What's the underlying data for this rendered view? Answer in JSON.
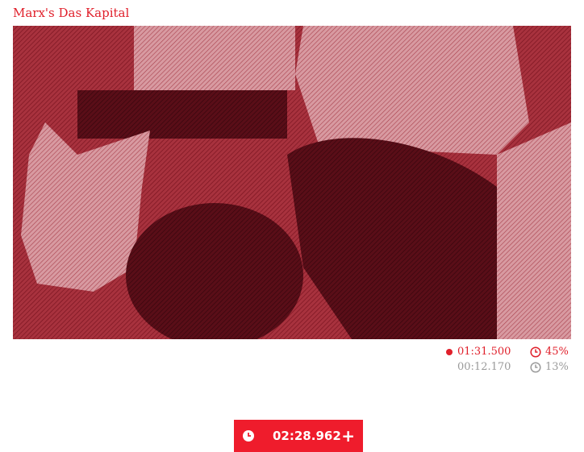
{
  "header": {
    "title": "Marx's Das Kapital"
  },
  "video": {
    "description_icon": "video-preview"
  },
  "stats": {
    "primary": {
      "time": "01:31.500",
      "percent": "45%"
    },
    "secondary": {
      "time": "00:12.170",
      "percent": "13%"
    }
  },
  "timer": {
    "value": "02:28.962",
    "add_symbol": "+"
  },
  "colors": {
    "accent": "#ef1c2c",
    "muted": "#9a9a9a",
    "overlay": "#a8323e"
  }
}
